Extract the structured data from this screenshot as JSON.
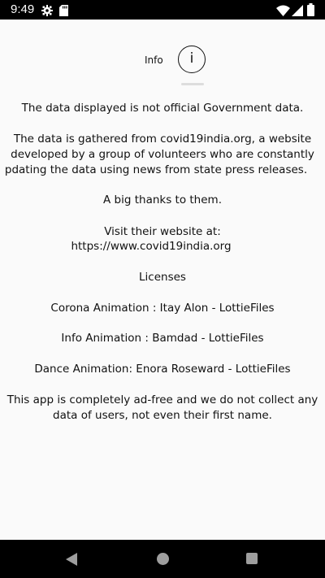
{
  "status_bar": {
    "time": "9:49",
    "icons": [
      "settings-icon",
      "sd-card-icon",
      "wifi-icon",
      "signal-icon",
      "battery-icon"
    ]
  },
  "header": {
    "info_label": "Info",
    "info_glyph": "i"
  },
  "content": {
    "disclaimer": "The data displayed is not official Government data.",
    "gathered_line1": "The data is gathered from covid19india.org, a website",
    "gathered_line2": "developed by a group of volunteers who are constantly",
    "gathered_line3": "pdating the data using news from state press releases.",
    "thanks": "A big thanks to them.",
    "visit_label": "Visit their website at:",
    "visit_url": "https://www.covid19india.org",
    "licenses_heading": "Licenses",
    "license_corona": "Corona Animation : Itay Alon - LottieFiles",
    "license_info": "Info Animation : Bamdad - LottieFiles",
    "license_dance": "Dance Animation: Enora Roseward - LottieFiles",
    "adfree_line1": "This app is completely ad-free and we do not collect any",
    "adfree_line2": "data of users, not even their first name."
  },
  "nav_bar": {
    "icons": [
      "back-icon",
      "home-icon",
      "recents-icon"
    ]
  }
}
